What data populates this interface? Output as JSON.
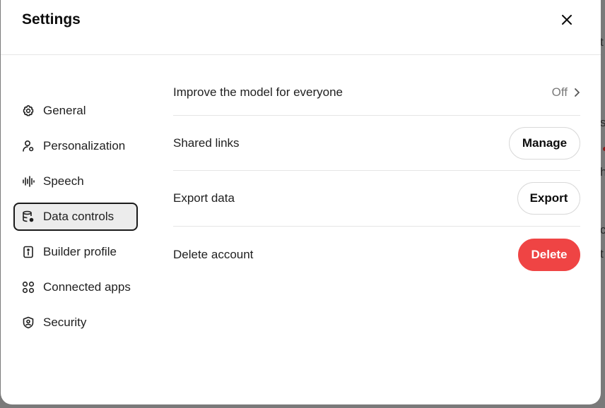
{
  "background": {
    "fragments": [
      "t",
      "s",
      "h",
      "c",
      "t"
    ]
  },
  "modal": {
    "title": "Settings",
    "close_icon": "close-icon"
  },
  "sidebar": {
    "items": [
      {
        "label": "General",
        "icon": "gear-icon"
      },
      {
        "label": "Personalization",
        "icon": "person-settings-icon"
      },
      {
        "label": "Speech",
        "icon": "waveform-icon"
      },
      {
        "label": "Data controls",
        "icon": "database-settings-icon",
        "active": true
      },
      {
        "label": "Builder profile",
        "icon": "id-card-icon"
      },
      {
        "label": "Connected apps",
        "icon": "apps-grid-icon"
      },
      {
        "label": "Security",
        "icon": "shield-icon"
      }
    ]
  },
  "data_controls": {
    "rows": [
      {
        "label": "Improve the model for everyone",
        "value": "Off"
      },
      {
        "label": "Shared links",
        "button": "Manage"
      },
      {
        "label": "Export data",
        "button": "Export"
      },
      {
        "label": "Delete account",
        "button": "Delete"
      }
    ]
  },
  "colors": {
    "delete": "#ef4444",
    "active_bg": "#ececec",
    "text": "#0d0d0d"
  }
}
